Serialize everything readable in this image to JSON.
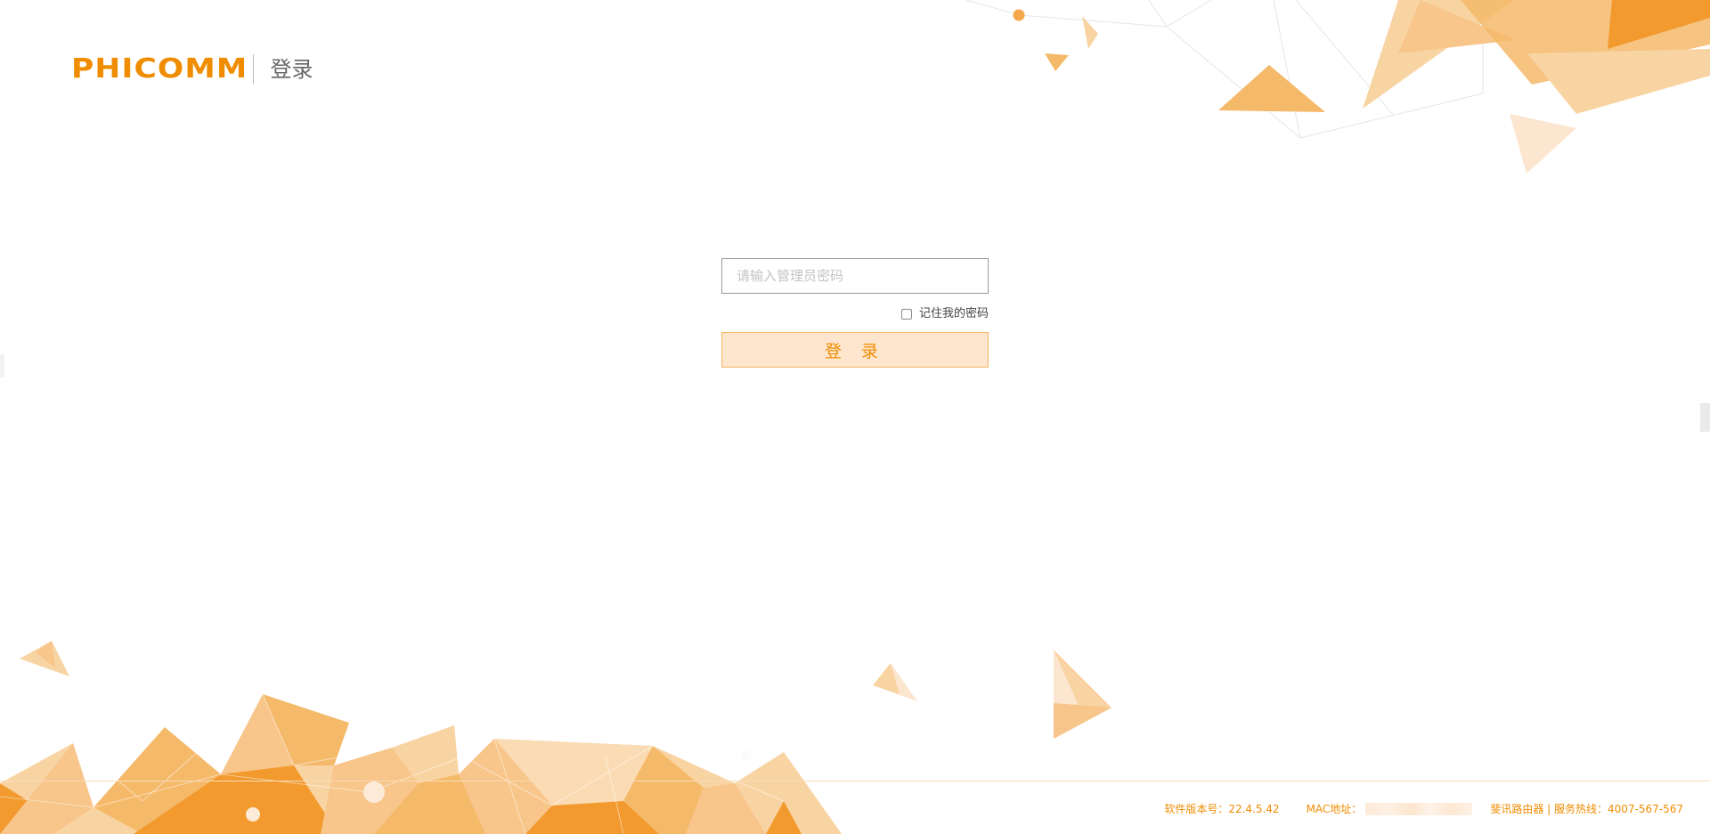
{
  "header": {
    "brand": "PHICOMM",
    "title": "登录"
  },
  "login": {
    "password_placeholder": "请输入管理员密码",
    "remember_label": "记住我的密码",
    "remember_checked": false,
    "submit_label": "登 录"
  },
  "footer": {
    "version_text": "软件版本号：22.4.5.42",
    "mac_label": "MAC地址：",
    "service_text": "斐讯路由器 | 服务热线：4007-567-567"
  },
  "colors": {
    "brand_orange": "#f08c00",
    "button_fill": "#fde6cd",
    "button_border": "#f4b766",
    "decor_light": "#f9d4a3",
    "decor_mid": "#f5b96a",
    "decor_dark": "#f29a2e"
  }
}
